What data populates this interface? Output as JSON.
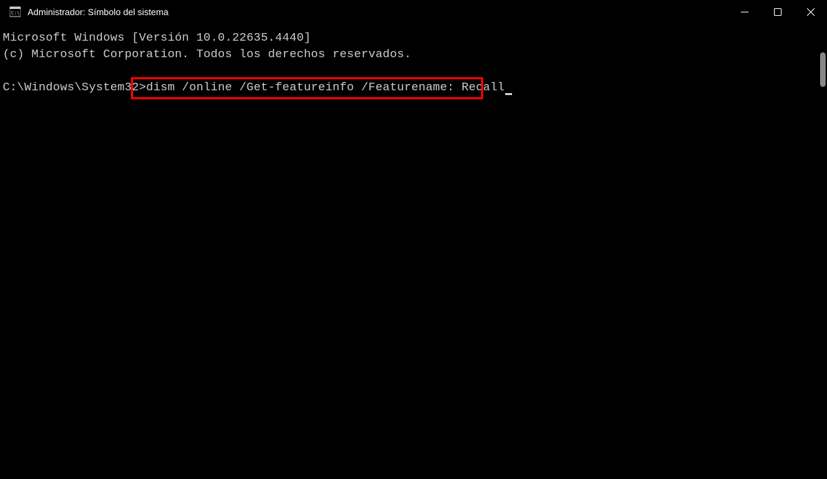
{
  "titlebar": {
    "title": "Administrador: Símbolo del sistema"
  },
  "terminal": {
    "line1": "Microsoft Windows [Versión 10.0.22635.4440]",
    "line2": "(c) Microsoft Corporation. Todos los derechos reservados.",
    "prompt": "C:\\Windows\\System32>",
    "command": "dism /online /Get-featureinfo /Featurename: Recall"
  }
}
